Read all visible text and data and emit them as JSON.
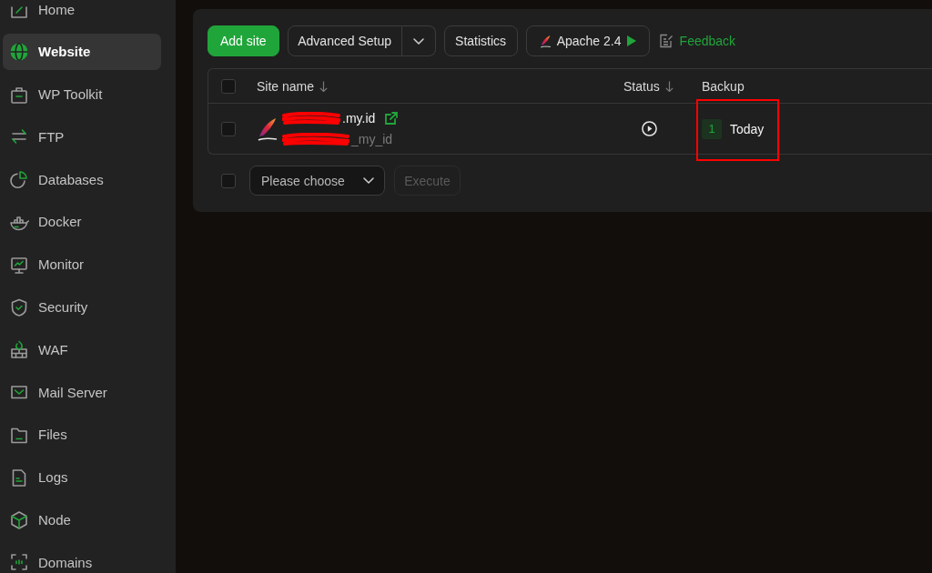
{
  "sidebar": {
    "items": [
      {
        "label": "Home",
        "selected": false
      },
      {
        "label": "Website",
        "selected": true
      },
      {
        "label": "WP Toolkit",
        "selected": false
      },
      {
        "label": "FTP",
        "selected": false
      },
      {
        "label": "Databases",
        "selected": false
      },
      {
        "label": "Docker",
        "selected": false
      },
      {
        "label": "Monitor",
        "selected": false
      },
      {
        "label": "Security",
        "selected": false
      },
      {
        "label": "WAF",
        "selected": false
      },
      {
        "label": "Mail Server",
        "selected": false
      },
      {
        "label": "Files",
        "selected": false
      },
      {
        "label": "Logs",
        "selected": false
      },
      {
        "label": "Node",
        "selected": false
      },
      {
        "label": "Domains",
        "selected": false
      }
    ]
  },
  "toolbar": {
    "add_button": "Add site",
    "advanced_button": "Advanced Setup",
    "statistics_button": "Statistics",
    "server_button": "Apache 2.4",
    "feedback_link": "Feedback"
  },
  "table": {
    "select_all": {
      "checked": false
    },
    "columns": [
      {
        "label": "Site name",
        "sortable": true
      },
      {
        "label": "Status",
        "sortable": true
      },
      {
        "label": "Backup",
        "sortable": false
      }
    ],
    "rows": [
      {
        "checked": false,
        "redacted": true,
        "name": ".my.id",
        "alias": "_my_id",
        "backup_count": "1",
        "backup_time": "Today",
        "highlighted": true
      }
    ]
  },
  "batch": {
    "checked": false,
    "select": {
      "placeholder": "Please choose"
    },
    "execute": {
      "label": "Execute",
      "disabled": true
    }
  }
}
